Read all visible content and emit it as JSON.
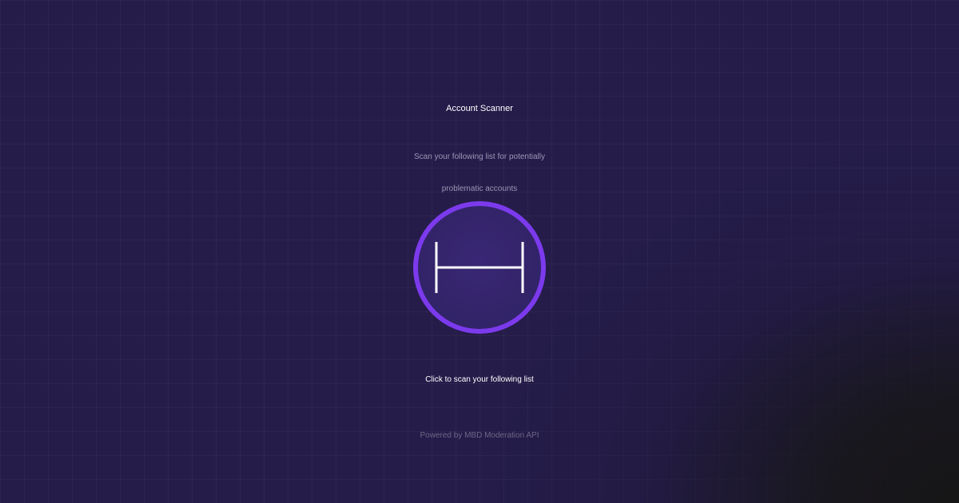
{
  "header": {
    "title": "Account Scanner",
    "subtitle_line1": "Scan your following list for potentially",
    "subtitle_line2": "problematic accounts"
  },
  "scan": {
    "icon": "h-bar-icon",
    "cta_label": "Click to scan your following list"
  },
  "footer": {
    "text": "Powered by MBD Moderation API"
  },
  "colors": {
    "background": "#251c4a",
    "accent": "#7c3aed",
    "button_fill": "#352570",
    "text_primary": "#ffffff",
    "text_secondary": "#9d96b4",
    "text_muted": "#6e6785"
  }
}
